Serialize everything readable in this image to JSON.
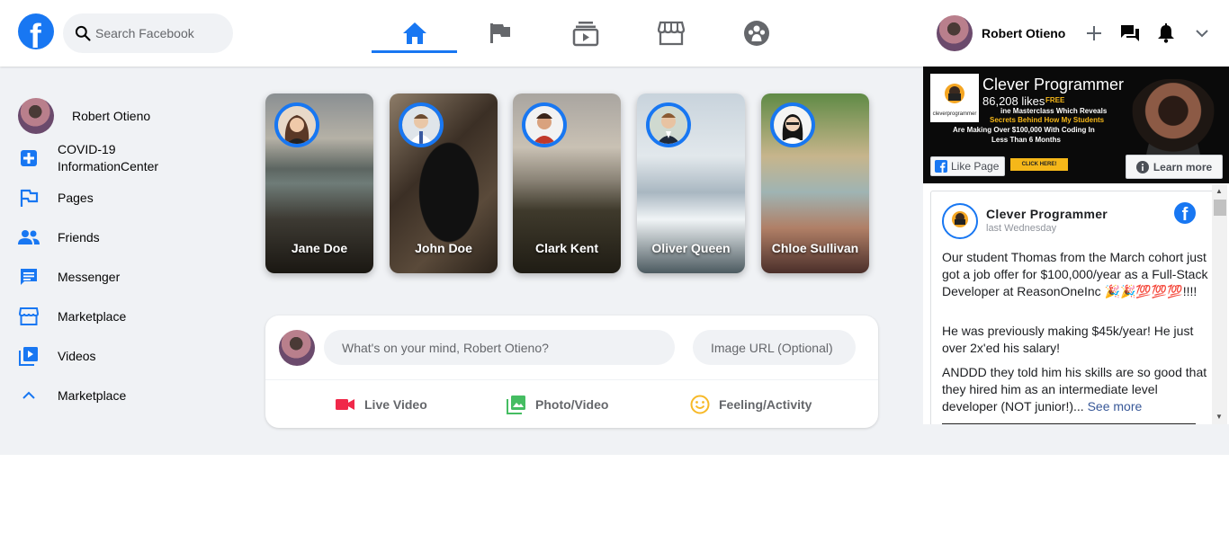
{
  "header": {
    "search_placeholder": "Search Facebook",
    "user_name": "Robert Otieno",
    "nav_tabs": [
      "home",
      "pages",
      "watch",
      "marketplace",
      "groups"
    ],
    "active_tab": "home",
    "right_icons": [
      "plus-icon",
      "messenger-icon",
      "bell-icon",
      "chevron-down-icon"
    ]
  },
  "sidebar": {
    "user": "Robert Otieno",
    "items": [
      {
        "label": "COVID-19 InformationCenter",
        "icon": "plus-square-icon"
      },
      {
        "label": "Pages",
        "icon": "flag-icon"
      },
      {
        "label": "Friends",
        "icon": "people-icon"
      },
      {
        "label": "Messenger",
        "icon": "chat-icon"
      },
      {
        "label": "Marketplace",
        "icon": "store-icon"
      },
      {
        "label": "Videos",
        "icon": "video-library-icon"
      },
      {
        "label": "Marketplace",
        "icon": "chevron-up-icon"
      }
    ]
  },
  "stories": [
    {
      "name": "Jane Doe"
    },
    {
      "name": "John Doe"
    },
    {
      "name": "Clark Kent"
    },
    {
      "name": "Oliver Queen"
    },
    {
      "name": "Chloe Sullivan"
    }
  ],
  "composer": {
    "placeholder": "What's on your mind, Robert Otieno?",
    "url_placeholder": "Image URL (Optional)",
    "options": [
      {
        "label": "Live Video",
        "color": "#f02849"
      },
      {
        "label": "Photo/Video",
        "color": "#45bd62"
      },
      {
        "label": "Feeling/Activity",
        "color": "#f7b928"
      }
    ]
  },
  "widget": {
    "page_name": "Clever Programmer",
    "likes": "86,208 likes",
    "cover_lines": [
      "FREE",
      "ine Masterclass Which Reveals",
      "Secrets Behind How My Students",
      "Are Making Over $100,000 With Coding In",
      "Less Than 6 Months"
    ],
    "cover_logo_text": "cleverprogrammer",
    "cover_cta": "CLICK HERE!",
    "like_button": "Like Page",
    "learn_more": "Learn more",
    "post": {
      "author": "Clever Programmer",
      "time": "last Wednesday",
      "p1": "Our student Thomas from the March cohort just got a job offer for $100,000/year as a Full-Stack Developer at ReasonOneInc 🎉🎉💯💯💯!!!!",
      "p2": "He was previously making $45k/year! He just over 2x'ed his salary!",
      "p3": "ANDDD they told him his skills are so good that they hired him as an intermediate level developer (NOT junior!)...",
      "see_more": "See more"
    }
  },
  "colors": {
    "brand": "#1877f2",
    "background": "#f0f2f5"
  }
}
